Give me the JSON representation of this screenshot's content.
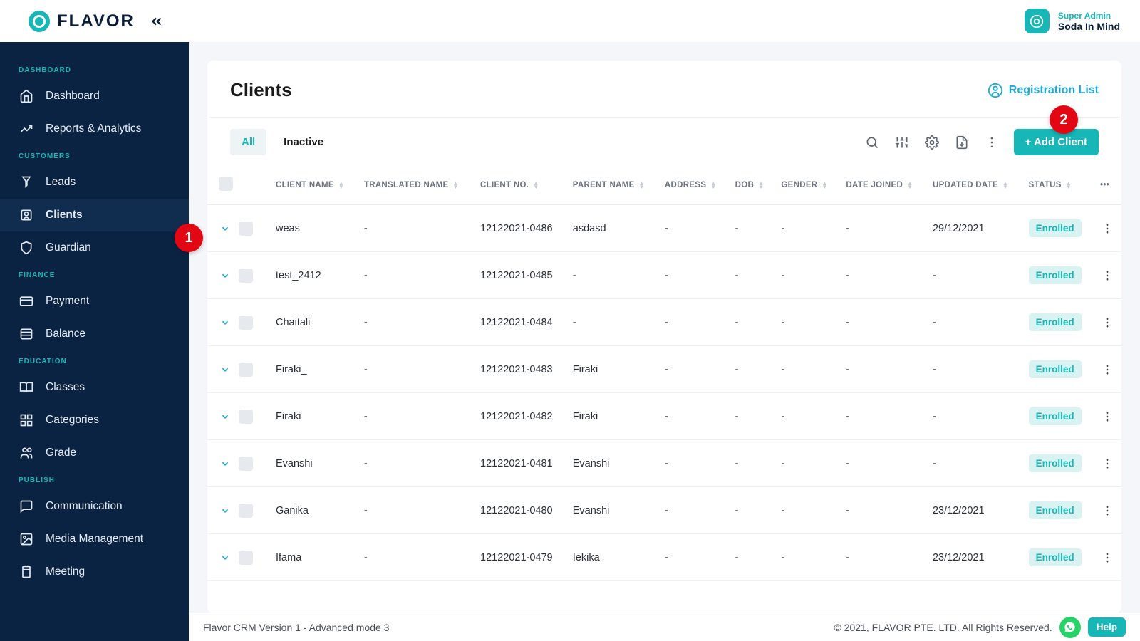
{
  "brand": "FLAVOR",
  "user": {
    "role": "Super Admin",
    "name": "Soda In Mind"
  },
  "sidebar": {
    "sections": [
      {
        "title": "DASHBOARD",
        "items": [
          {
            "label": "Dashboard",
            "icon": "home"
          },
          {
            "label": "Reports & Analytics",
            "icon": "chart"
          }
        ]
      },
      {
        "title": "CUSTOMERS",
        "items": [
          {
            "label": "Leads",
            "icon": "leads"
          },
          {
            "label": "Clients",
            "icon": "user",
            "active": true
          },
          {
            "label": "Guardian",
            "icon": "shield"
          }
        ]
      },
      {
        "title": "FINANCE",
        "items": [
          {
            "label": "Payment",
            "icon": "card"
          },
          {
            "label": "Balance",
            "icon": "balance"
          }
        ]
      },
      {
        "title": "EDUCATION",
        "items": [
          {
            "label": "Classes",
            "icon": "book"
          },
          {
            "label": "Categories",
            "icon": "cats"
          },
          {
            "label": "Grade",
            "icon": "grade"
          }
        ]
      },
      {
        "title": "PUBLISH",
        "items": [
          {
            "label": "Communication",
            "icon": "comm"
          },
          {
            "label": "Media Management",
            "icon": "media"
          },
          {
            "label": "Meeting",
            "icon": "meeting"
          }
        ]
      }
    ]
  },
  "page": {
    "title": "Clients",
    "registration": "Registration List",
    "tabs": [
      "All",
      "Inactive"
    ],
    "activeTab": "All",
    "addBtn": "+ Add Client",
    "columns": [
      "CLIENT NAME",
      "TRANSLATED NAME",
      "CLIENT NO.",
      "PARENT NAME",
      "ADDRESS",
      "DOB",
      "GENDER",
      "DATE JOINED",
      "UPDATED DATE",
      "STATUS"
    ],
    "rows": [
      {
        "name": "weas",
        "trans": "-",
        "no": "12122021-0486",
        "parent": "asdasd",
        "addr": "-",
        "dob": "-",
        "gender": "-",
        "joined": "-",
        "updated": "29/12/2021",
        "status": "Enrolled"
      },
      {
        "name": "test_2412",
        "trans": "-",
        "no": "12122021-0485",
        "parent": "-",
        "addr": "-",
        "dob": "-",
        "gender": "-",
        "joined": "-",
        "updated": "-",
        "status": "Enrolled"
      },
      {
        "name": "Chaitali",
        "trans": "-",
        "no": "12122021-0484",
        "parent": "-",
        "addr": "-",
        "dob": "-",
        "gender": "-",
        "joined": "-",
        "updated": "-",
        "status": "Enrolled"
      },
      {
        "name": "Firaki_",
        "trans": "-",
        "no": "12122021-0483",
        "parent": "Firaki",
        "addr": "-",
        "dob": "-",
        "gender": "-",
        "joined": "-",
        "updated": "-",
        "status": "Enrolled"
      },
      {
        "name": "Firaki",
        "trans": "-",
        "no": "12122021-0482",
        "parent": "Firaki",
        "addr": "-",
        "dob": "-",
        "gender": "-",
        "joined": "-",
        "updated": "-",
        "status": "Enrolled"
      },
      {
        "name": "Evanshi",
        "trans": "-",
        "no": "12122021-0481",
        "parent": "Evanshi",
        "addr": "-",
        "dob": "-",
        "gender": "-",
        "joined": "-",
        "updated": "-",
        "status": "Enrolled"
      },
      {
        "name": "Ganika",
        "trans": "-",
        "no": "12122021-0480",
        "parent": "Evanshi",
        "addr": "-",
        "dob": "-",
        "gender": "-",
        "joined": "-",
        "updated": "23/12/2021",
        "status": "Enrolled"
      },
      {
        "name": "Ifama",
        "trans": "-",
        "no": "12122021-0479",
        "parent": "Iekika",
        "addr": "-",
        "dob": "-",
        "gender": "-",
        "joined": "-",
        "updated": "23/12/2021",
        "status": "Enrolled"
      }
    ]
  },
  "footer": {
    "left": "Flavor CRM Version 1 - Advanced mode 3",
    "right": "© 2021, FLAVOR PTE. LTD. All Rights Reserved.",
    "help": "Help"
  },
  "markers": {
    "1": "1",
    "2": "2"
  }
}
